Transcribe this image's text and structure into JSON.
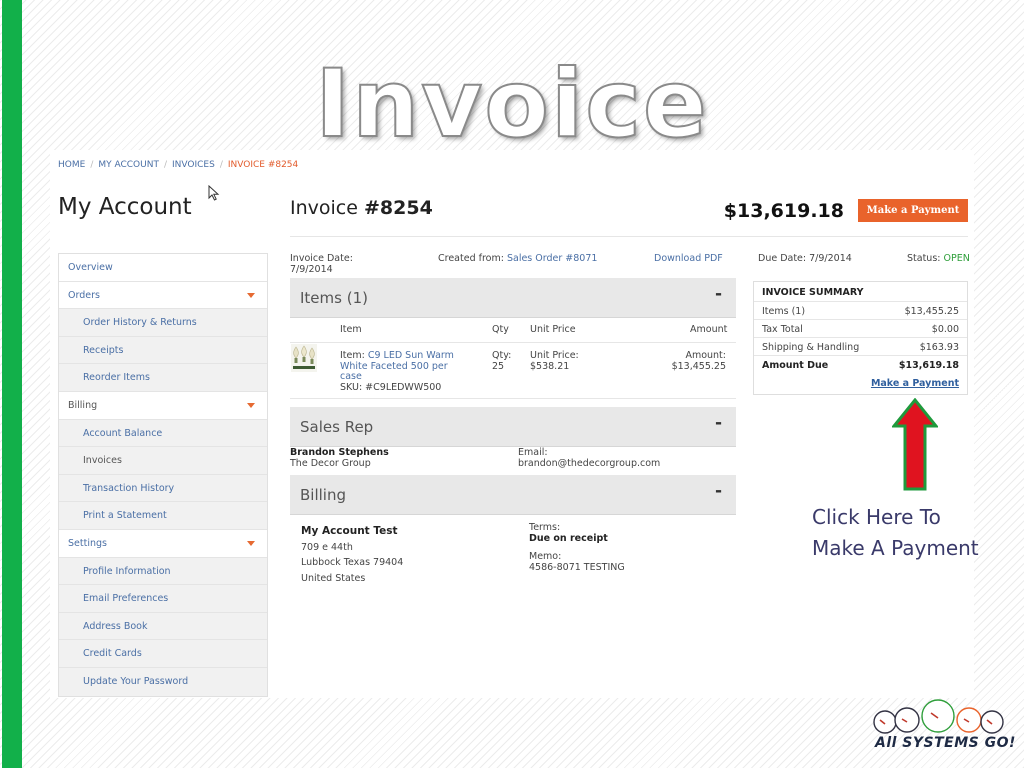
{
  "slide": {
    "title": "Invoice",
    "note": "Click Here To Make A Payment",
    "logo_text": "All SYSTEMS GO!"
  },
  "breadcrumb": [
    "HOME",
    "MY ACCOUNT",
    "INVOICES",
    "INVOICE #8254"
  ],
  "sidebar": {
    "heading": "My Account",
    "items": [
      {
        "label": "Overview"
      },
      {
        "label": "Orders"
      },
      {
        "label": "Order History & Returns"
      },
      {
        "label": "Receipts"
      },
      {
        "label": "Reorder Items"
      },
      {
        "label": "Billing"
      },
      {
        "label": "Account Balance"
      },
      {
        "label": "Invoices"
      },
      {
        "label": "Transaction History"
      },
      {
        "label": "Print a Statement"
      },
      {
        "label": "Settings"
      },
      {
        "label": "Profile Information"
      },
      {
        "label": "Email Preferences"
      },
      {
        "label": "Address Book"
      },
      {
        "label": "Credit Cards"
      },
      {
        "label": "Update Your Password"
      }
    ]
  },
  "invoice": {
    "title_prefix": "Invoice",
    "number": "#8254",
    "total": "$13,619.18",
    "pay_button": "Make a Payment",
    "date_label": "Invoice Date:",
    "date": "7/9/2014",
    "created_from_label": "Created from:",
    "created_from": "Sales Order #8071",
    "download": "Download PDF",
    "due_date": "Due Date: 7/9/2014",
    "status_label": "Status:",
    "status": "OPEN"
  },
  "items": {
    "header": "Items (1)",
    "toggle": "-",
    "columns": [
      "Item",
      "Qty",
      "Unit Price",
      "Amount"
    ],
    "rows": [
      {
        "item_label": "Item:",
        "item_name": "C9 LED Sun Warm White Faceted 500 per case",
        "sku": "SKU: #C9LEDWW500",
        "qty_label": "Qty:",
        "qty": "25",
        "unit_price_label": "Unit Price:",
        "unit_price": "$538.21",
        "amount_label": "Amount:",
        "amount": "$13,455.25"
      }
    ]
  },
  "summary": {
    "title": "INVOICE SUMMARY",
    "rows": [
      {
        "label": "Items (1)",
        "value": "$13,455.25"
      },
      {
        "label": "Tax Total",
        "value": "$0.00"
      },
      {
        "label": "Shipping & Handling",
        "value": "$163.93"
      },
      {
        "label": "Amount Due",
        "value": "$13,619.18"
      }
    ],
    "pay_link": "Make a Payment"
  },
  "sales_rep": {
    "header": "Sales Rep",
    "toggle": "-",
    "name": "Brandon Stephens",
    "company": "The Decor Group",
    "email_label": "Email:",
    "email": "brandon@thedecorgroup.com"
  },
  "billing": {
    "header": "Billing",
    "toggle": "-",
    "name": "My Account Test",
    "address1": "709 e 44th",
    "address2": "Lubbock Texas 79404",
    "country": "United States",
    "terms_label": "Terms:",
    "terms": "Due on receipt",
    "memo_label": "Memo:",
    "memo": "4586-8071 TESTING"
  },
  "colors": {
    "accent": "#e9632b",
    "link": "#4a6fa5",
    "status_open": "#2e9e3a",
    "arrow": "#e0131f",
    "side_bar": "#12b04a"
  }
}
